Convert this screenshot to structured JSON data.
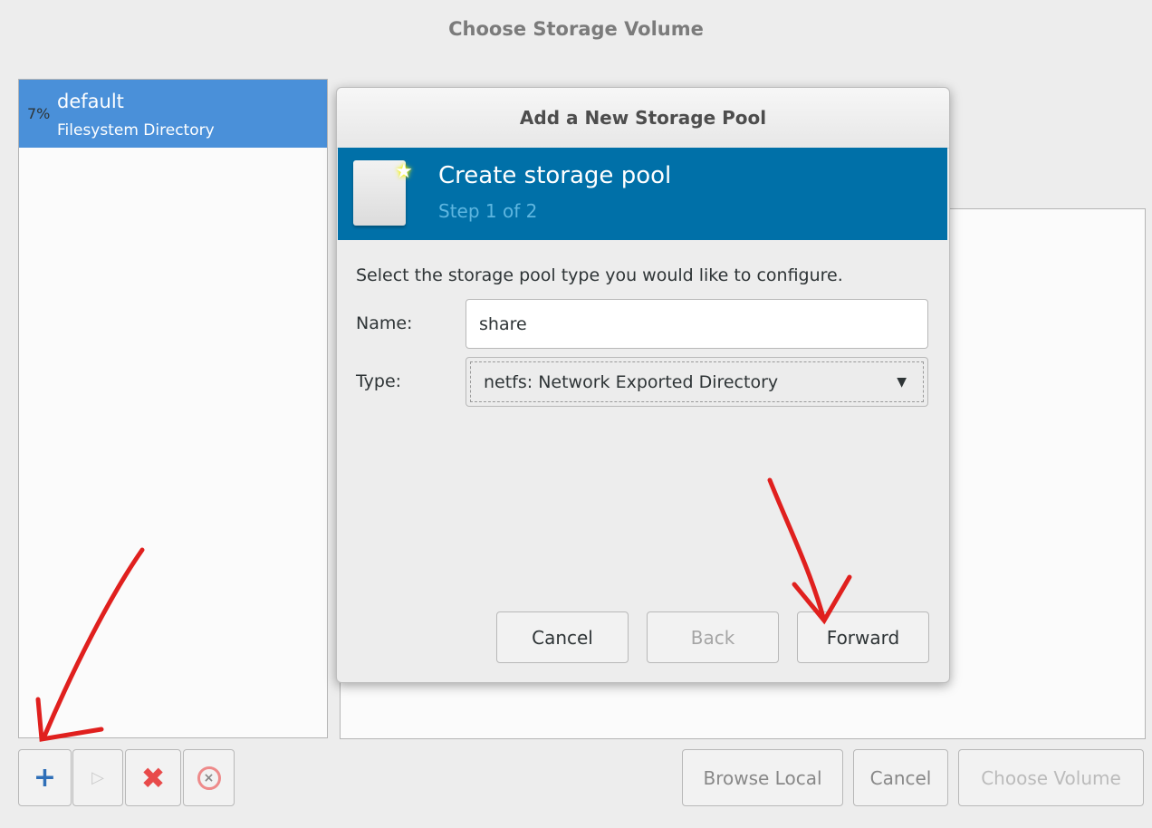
{
  "window": {
    "title": "Choose Storage Volume"
  },
  "pools": [
    {
      "usage": "7%",
      "name": "default",
      "type": "Filesystem Directory"
    }
  ],
  "toolbar": {
    "add": "add-pool",
    "start": "start-pool",
    "delete": "delete-pool",
    "stop": "stop-pool"
  },
  "footer": {
    "browse_local": "Browse Local",
    "cancel": "Cancel",
    "choose_volume": "Choose Volume"
  },
  "dialog": {
    "title": "Add a New Storage Pool",
    "banner_title": "Create storage pool",
    "banner_step": "Step 1 of 2",
    "instruction": "Select the storage pool type you would like to configure.",
    "name_label": "Name:",
    "name_value": "share",
    "type_label": "Type:",
    "type_value": "netfs: Network Exported Directory",
    "cancel": "Cancel",
    "back": "Back",
    "forward": "Forward"
  },
  "colors": {
    "selection": "#4a90d9",
    "banner": "#0070a8",
    "annotation": "#e0201e"
  }
}
